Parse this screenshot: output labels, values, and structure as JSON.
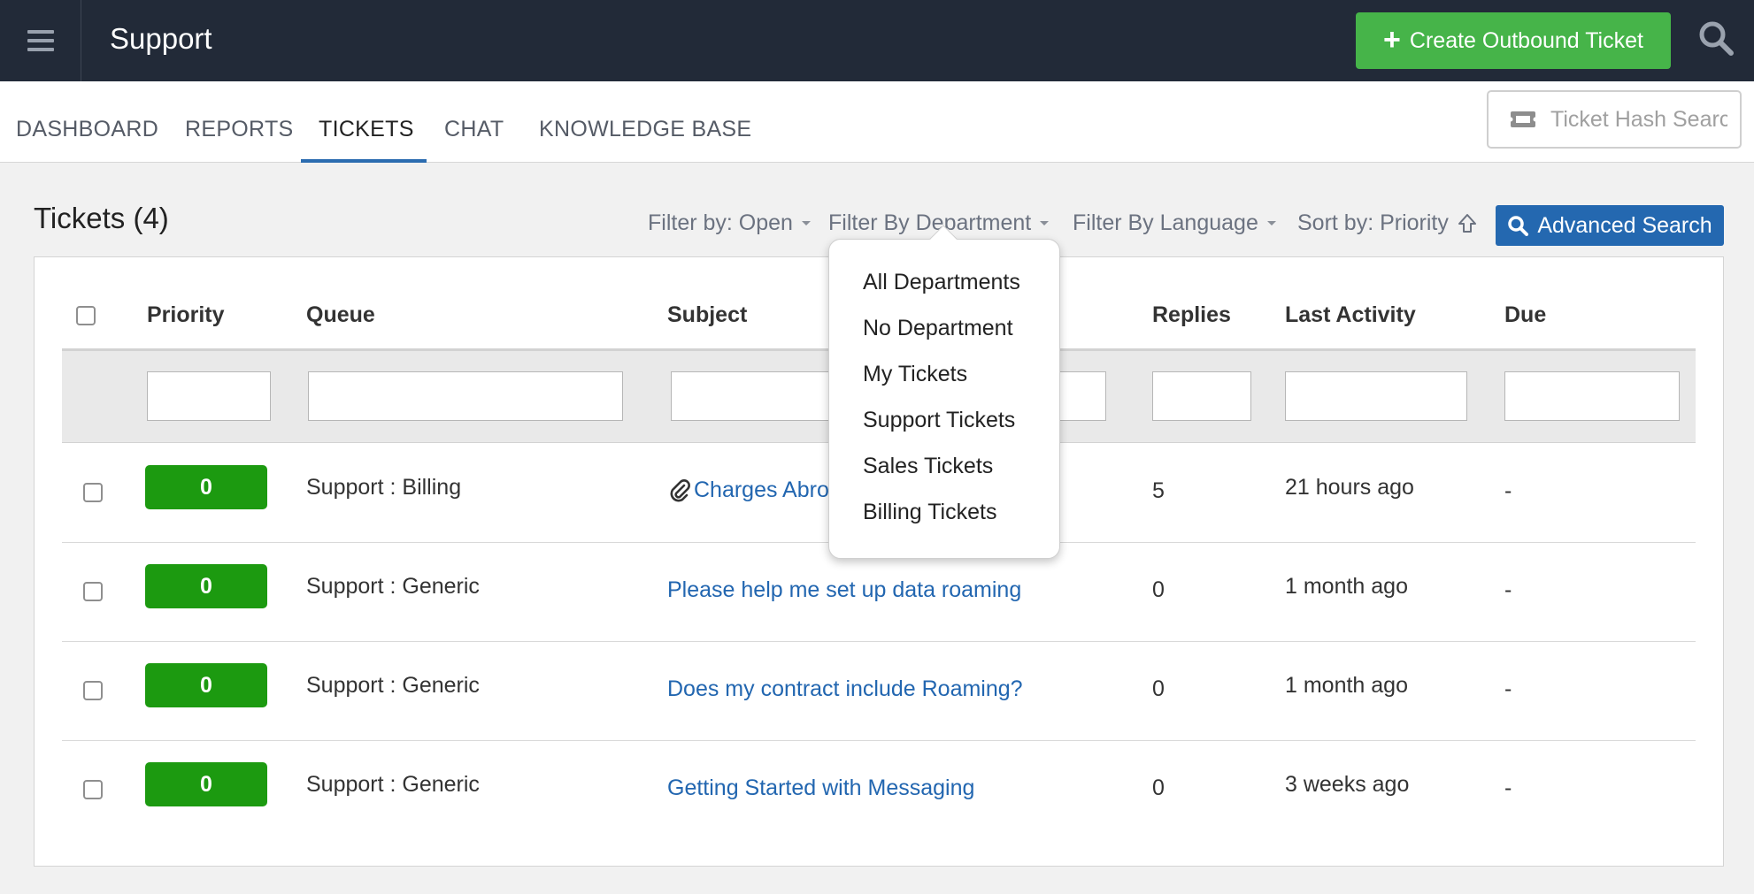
{
  "topbar": {
    "title": "Support",
    "create_button_label": "Create Outbound Ticket",
    "menu_icon": "hamburger-icon",
    "search_icon": "search-icon",
    "background_color": "#222a38",
    "create_button_color": "#46b449"
  },
  "nav": {
    "tabs": [
      {
        "label": "DASHBOARD"
      },
      {
        "label": "REPORTS"
      },
      {
        "label": "TICKETS"
      },
      {
        "label": "CHAT"
      },
      {
        "label": "KNOWLEDGE BASE"
      }
    ],
    "active_tab": "TICKETS",
    "hash_search_placeholder": "Ticket Hash Search",
    "hash_search_icon": "ticket-icon"
  },
  "tickets": {
    "title": "Tickets (4)",
    "filters": {
      "status": "Filter by: Open",
      "department": "Filter By Department",
      "language": "Filter By Language",
      "sort": "Sort by: Priority"
    },
    "advanced_search_label": "Advanced Search",
    "columns": {
      "priority": "Priority",
      "queue": "Queue",
      "subject": "Subject",
      "replies": "Replies",
      "last_activity": "Last Activity",
      "due": "Due"
    },
    "rows": [
      {
        "priority": "0",
        "queue": "Support : Billing",
        "subject": "Charges Abro",
        "attachment": true,
        "replies": "5",
        "last_activity": "21 hours ago",
        "due": "-"
      },
      {
        "priority": "0",
        "queue": "Support : Generic",
        "subject": "Please help me set up data roaming",
        "attachment": false,
        "replies": "0",
        "last_activity": "1 month ago",
        "due": "-"
      },
      {
        "priority": "0",
        "queue": "Support : Generic",
        "subject": "Does my contract include Roaming?",
        "attachment": false,
        "replies": "0",
        "last_activity": "1 month ago",
        "due": "-"
      },
      {
        "priority": "0",
        "queue": "Support : Generic",
        "subject": "Getting Started with Messaging",
        "attachment": false,
        "replies": "0",
        "last_activity": "3 weeks ago",
        "due": "-"
      }
    ],
    "priority_badge_color": "#1c9a10",
    "link_color": "#2266b0"
  },
  "department_dropdown": {
    "open": true,
    "items": [
      {
        "label": "All Departments"
      },
      {
        "label": "No Department"
      },
      {
        "label": "My Tickets"
      },
      {
        "label": "Support Tickets"
      },
      {
        "label": "Sales Tickets"
      },
      {
        "label": "Billing Tickets"
      }
    ]
  }
}
